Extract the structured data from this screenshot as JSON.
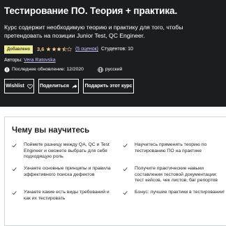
{
  "course": {
    "title": "Тестирование ПО. Теория + практика.",
    "subtitle": "Курс содержит необходимую теорию и практику для того, чтобы претендовать на позиции Junior Test, QC Engineer.",
    "badge": "Добавлено",
    "rating_value": "3,6",
    "rating_stars": 3.6,
    "ratings_count": "(5 оценок)",
    "students": "Студентов: 10",
    "author_label": "Авторы:",
    "author_name": "Vera Ratovska",
    "last_updated": "Последнее обновление: 12/2020",
    "language": "русский"
  },
  "buttons": {
    "wishlist": "Wishlist",
    "share": "Поделиться",
    "gift": "Подарить этот курс"
  },
  "learn": {
    "title": "Чему вы научитесь",
    "items": [
      "Поймете разницу между QA, QC и Test Engineer и сможете выбрать для себя подходящую роль",
      "Научитесь применять теорию по тестированию ПО на практике",
      "Узнаете основные принципы и правила эффективного поиска дефектов",
      "Получите практические навыки составления тестовой документации: тест кейсов, чек листов, баг репортов",
      "Узнаете какие есть виды требований и как их тестировать",
      "Бонус: лучшие практики в тестировании!"
    ]
  },
  "colors": {
    "hero_bg": "#1c1d1f",
    "badge_bg": "#eceb98",
    "rating": "#f3ca8c",
    "link": "#cec0fc"
  }
}
